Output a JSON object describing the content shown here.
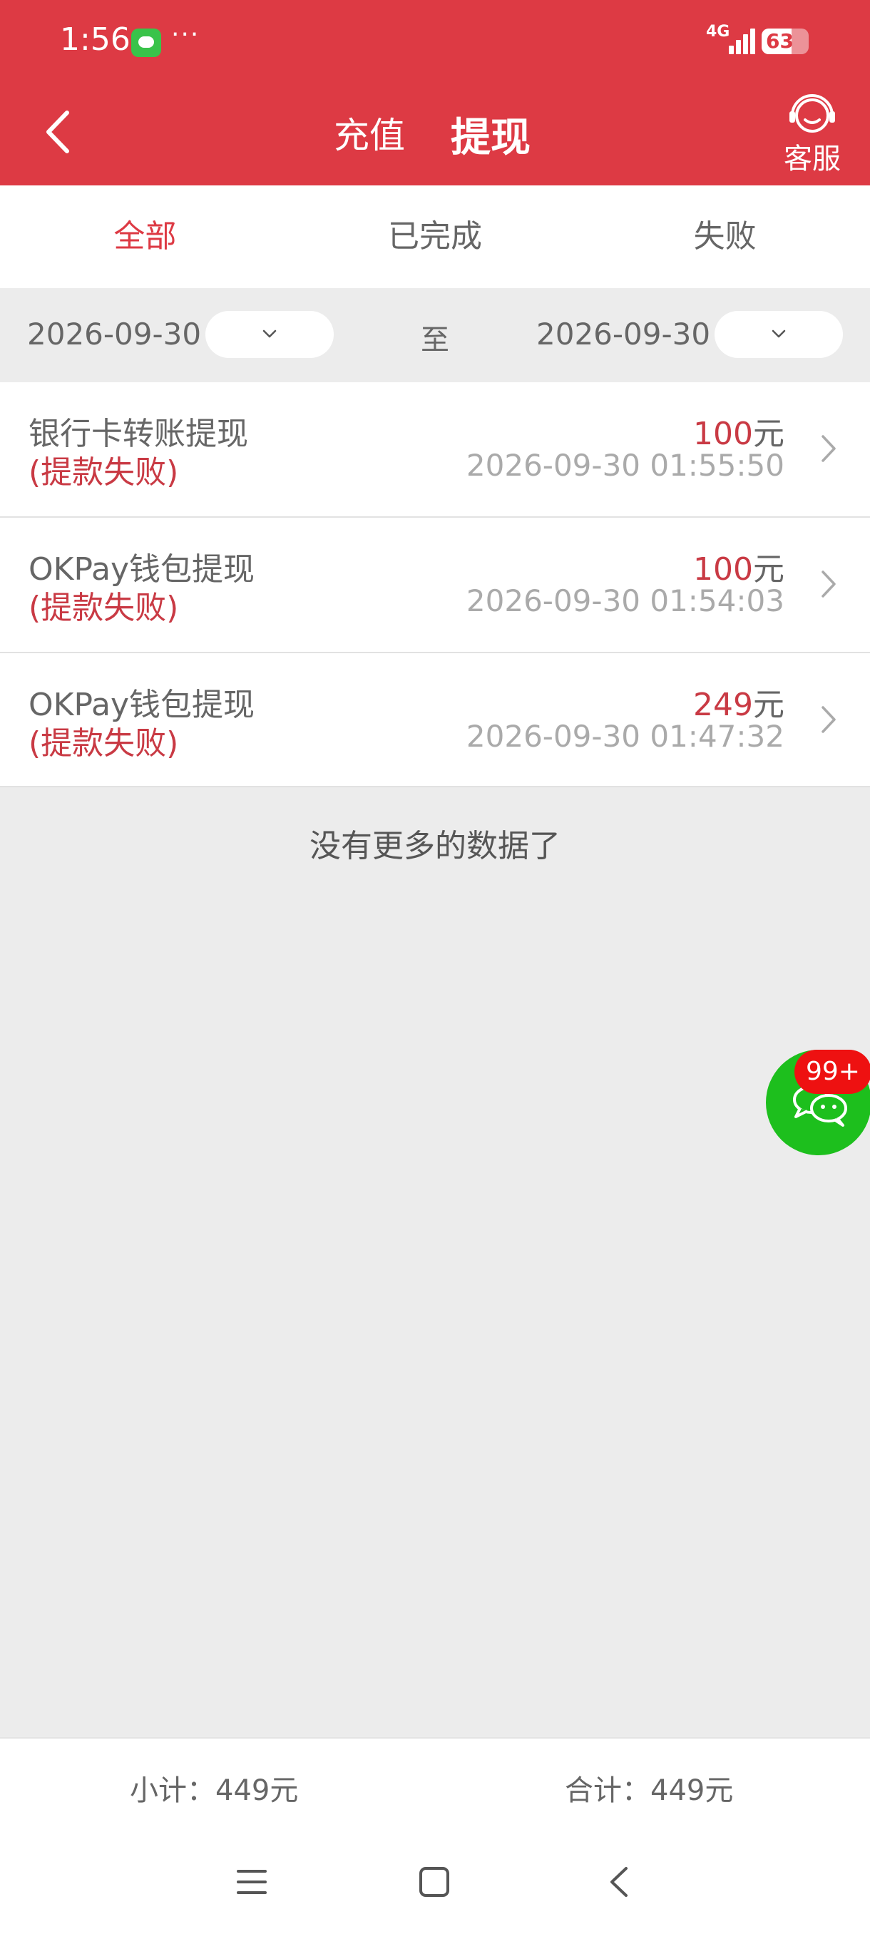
{
  "status_bar": {
    "time": "1:56",
    "more": "···",
    "network": "4G",
    "battery": "63",
    "battery_level": 0.63
  },
  "header": {
    "tab_recharge": "充值",
    "tab_withdraw": "提现",
    "service_label": "客服"
  },
  "filter_tabs": [
    {
      "label": "全部",
      "active": true
    },
    {
      "label": "已完成",
      "active": false
    },
    {
      "label": "失败",
      "active": false
    }
  ],
  "date_range": {
    "start": "2026-09-30",
    "separator": "至",
    "end": "2026-09-30"
  },
  "records": [
    {
      "title": "银行卡转账提现",
      "status": "(提款失败)",
      "amount": "100",
      "unit": "元",
      "time": "2026-09-30 01:55:50"
    },
    {
      "title": "OKPay钱包提现",
      "status": "(提款失败)",
      "amount": "100",
      "unit": "元",
      "time": "2026-09-30 01:54:03"
    },
    {
      "title": "OKPay钱包提现",
      "status": "(提款失败)",
      "amount": "249",
      "unit": "元",
      "time": "2026-09-30 01:47:32"
    }
  ],
  "no_more_text": "没有更多的数据了",
  "chat_badge": "99+",
  "summary": {
    "subtotal": "小计：449元",
    "total": "合计：449元"
  },
  "colors": {
    "brand_red": "#dd3a44",
    "status_red": "#c93a44",
    "chat_green": "#1dbf1d",
    "badge_red": "#ee1111"
  }
}
